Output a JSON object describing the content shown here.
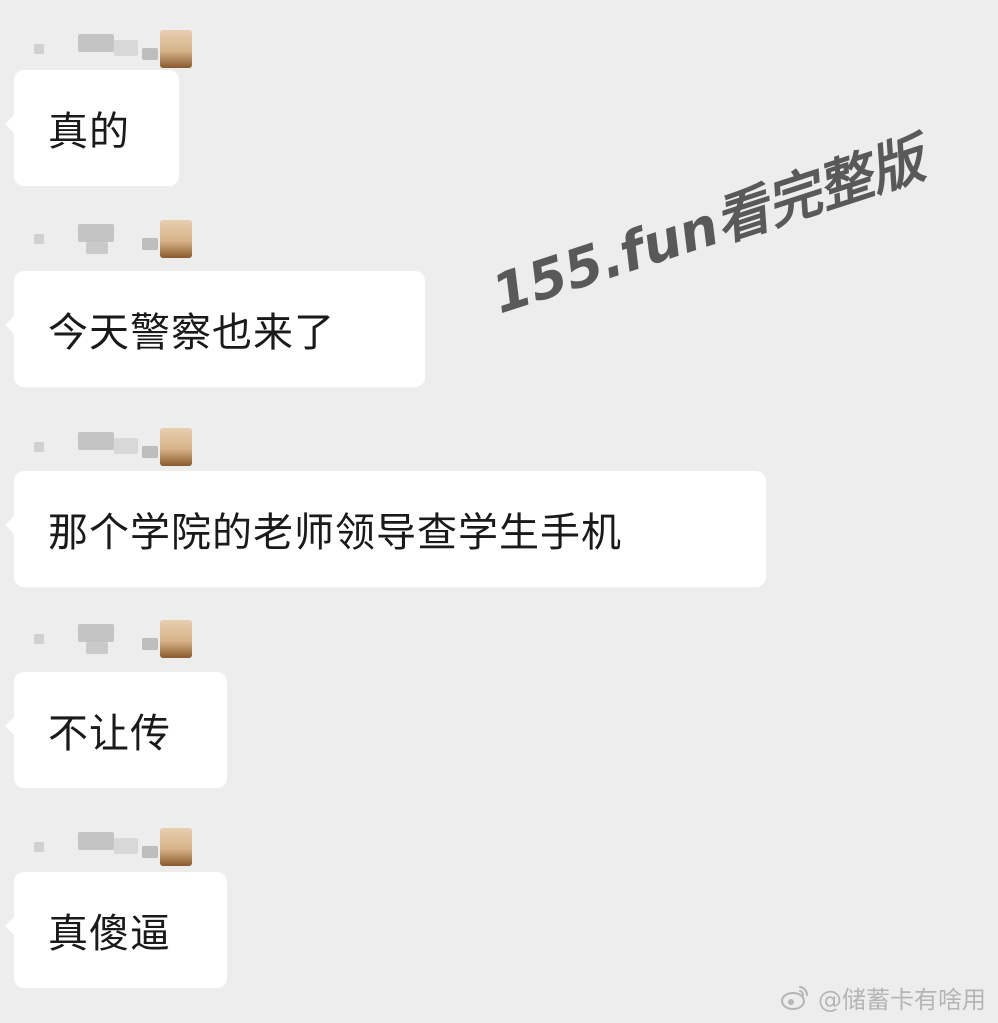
{
  "messages": [
    {
      "text": "真的"
    },
    {
      "text": "今天警察也来了"
    },
    {
      "text": "那个学院的老师领导查学生手机"
    },
    {
      "text": "不让传"
    },
    {
      "text": "真傻逼"
    }
  ],
  "watermark": "155.fun看完整版",
  "credit": {
    "icon": "weibo-icon",
    "text": "@储蓄卡有啥用"
  },
  "colors": {
    "background": "#ededed",
    "bubble": "#ffffff",
    "text": "#1a1a1a",
    "watermark": "#4d4d4d"
  }
}
